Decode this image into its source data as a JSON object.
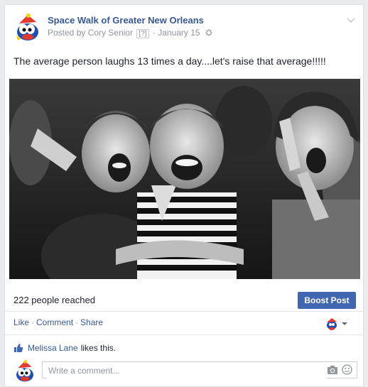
{
  "post": {
    "page_name": "Space Walk of Greater New Orleans",
    "posted_by_prefix": "Posted by",
    "author": "Cory Senior",
    "help_mark": "[?]",
    "date": "January 15",
    "text": "The average person laughs 13 times a day....let's raise that average!!!!!",
    "photo_subject": "black-and-white photo of laughing children"
  },
  "insights": {
    "reach_text": "222 people reached",
    "boost_label": "Boost Post"
  },
  "actions": {
    "like": "Like",
    "comment": "Comment",
    "share": "Share",
    "separator": "·"
  },
  "likes": {
    "name": "Melissa Lane",
    "suffix": "likes this."
  },
  "comment_box": {
    "placeholder": "Write a comment..."
  },
  "colors": {
    "link": "#365899",
    "boost": "#4267b2",
    "meta": "#90949c"
  },
  "icons": [
    "avatar-logo",
    "globe-icon",
    "chevron-down-icon",
    "thumbs-up-icon",
    "camera-icon",
    "smiley-icon"
  ]
}
